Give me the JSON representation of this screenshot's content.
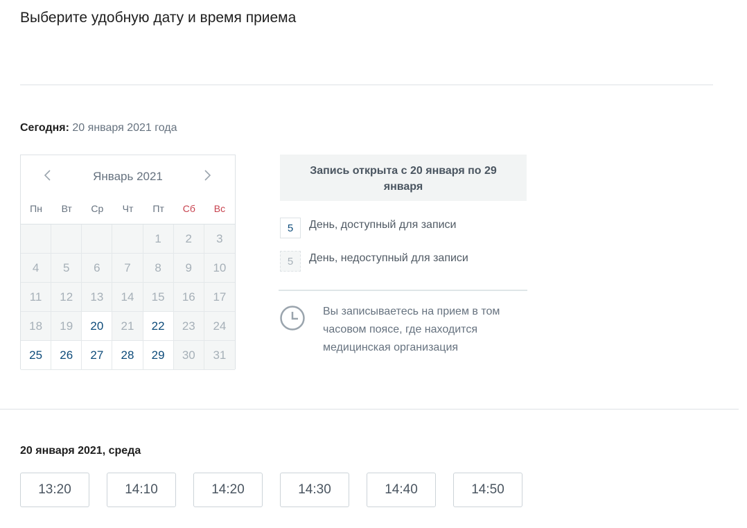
{
  "page": {
    "title": "Выберите удобную дату и время приема"
  },
  "today": {
    "label": "Сегодня:",
    "value": "20 января 2021 года"
  },
  "calendar": {
    "month_label": "Январь 2021",
    "weekdays": [
      "Пн",
      "Вт",
      "Ср",
      "Чт",
      "Пт",
      "Сб",
      "Вс"
    ],
    "weekend_color": "#c7424e",
    "available_color": "#0d4b7a",
    "days": [
      {
        "label": "",
        "state": "empty"
      },
      {
        "label": "",
        "state": "empty"
      },
      {
        "label": "",
        "state": "empty"
      },
      {
        "label": "",
        "state": "empty"
      },
      {
        "label": "1",
        "state": "unavailable"
      },
      {
        "label": "2",
        "state": "unavailable"
      },
      {
        "label": "3",
        "state": "unavailable"
      },
      {
        "label": "4",
        "state": "unavailable"
      },
      {
        "label": "5",
        "state": "unavailable"
      },
      {
        "label": "6",
        "state": "unavailable"
      },
      {
        "label": "7",
        "state": "unavailable"
      },
      {
        "label": "8",
        "state": "unavailable"
      },
      {
        "label": "9",
        "state": "unavailable"
      },
      {
        "label": "10",
        "state": "unavailable"
      },
      {
        "label": "11",
        "state": "unavailable"
      },
      {
        "label": "12",
        "state": "unavailable"
      },
      {
        "label": "13",
        "state": "unavailable"
      },
      {
        "label": "14",
        "state": "unavailable"
      },
      {
        "label": "15",
        "state": "unavailable"
      },
      {
        "label": "16",
        "state": "unavailable"
      },
      {
        "label": "17",
        "state": "unavailable"
      },
      {
        "label": "18",
        "state": "unavailable"
      },
      {
        "label": "19",
        "state": "unavailable"
      },
      {
        "label": "20",
        "state": "available"
      },
      {
        "label": "21",
        "state": "unavailable"
      },
      {
        "label": "22",
        "state": "available"
      },
      {
        "label": "23",
        "state": "unavailable"
      },
      {
        "label": "24",
        "state": "unavailable"
      },
      {
        "label": "25",
        "state": "available"
      },
      {
        "label": "26",
        "state": "available"
      },
      {
        "label": "27",
        "state": "available"
      },
      {
        "label": "28",
        "state": "available"
      },
      {
        "label": "29",
        "state": "available"
      },
      {
        "label": "30",
        "state": "unavailable"
      },
      {
        "label": "31",
        "state": "unavailable"
      }
    ]
  },
  "info": {
    "banner": "Запись открыта с 20 января по 29 января",
    "legend_available_number": "5",
    "legend_available_text": "День, доступный для записи",
    "legend_unavailable_number": "5",
    "legend_unavailable_text": "День, недоступный для записи",
    "timezone_note": "Вы записываетесь на прием в том часовом поясе, где находится медицинская организация",
    "timezone_icon": "clock-icon"
  },
  "schedule": {
    "selected_date": "20 января 2021, среда",
    "slots": [
      "13:20",
      "14:10",
      "14:20",
      "14:30",
      "14:40",
      "14:50"
    ]
  }
}
